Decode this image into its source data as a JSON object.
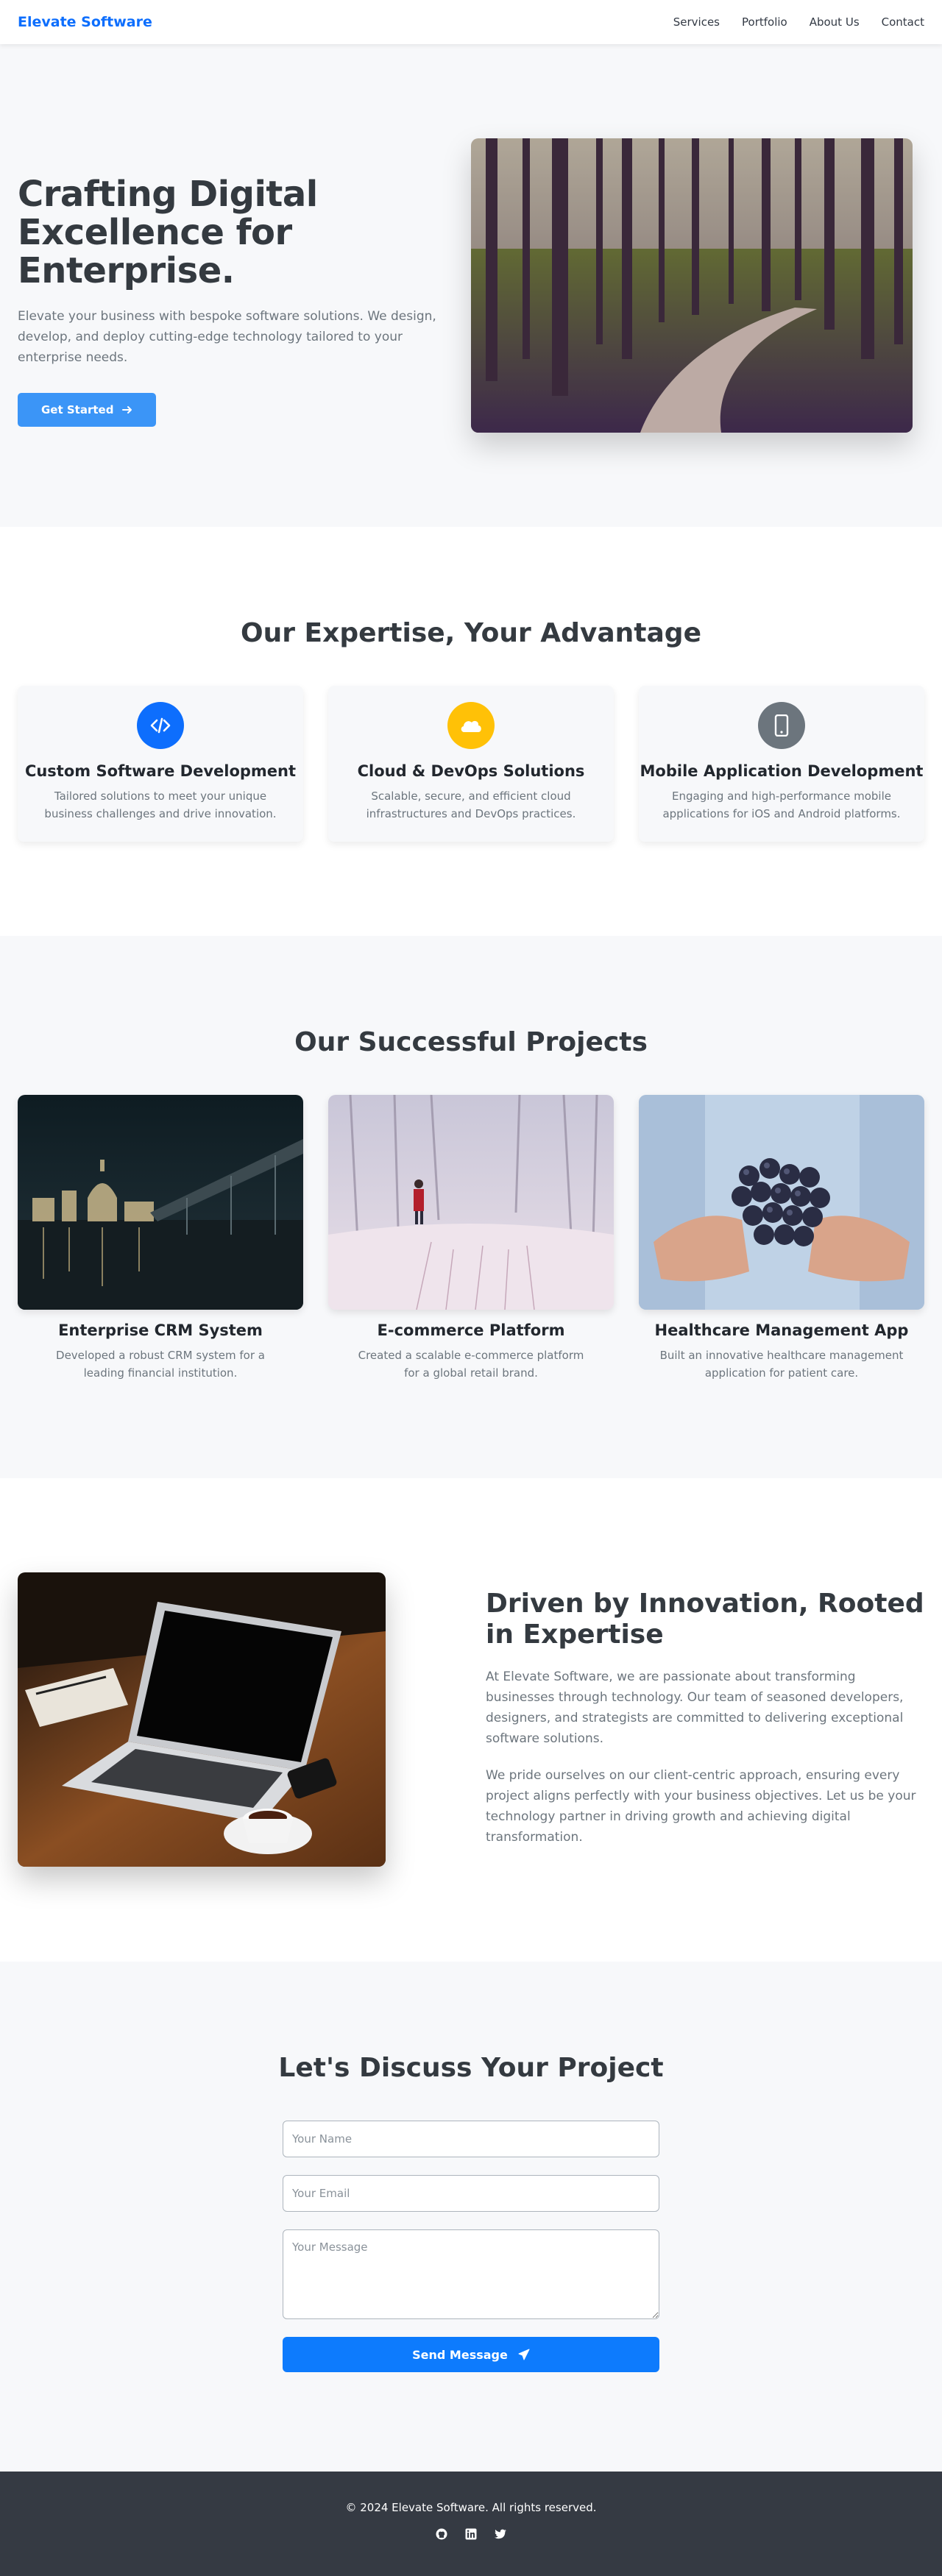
{
  "nav": {
    "brand": "Elevate Software",
    "links": [
      "Services",
      "Portfolio",
      "About Us",
      "Contact"
    ]
  },
  "hero": {
    "title_line1": "Crafting Digital",
    "title_line2": "Excellence for Enterprise.",
    "subtitle": "Elevate your business with bespoke software solutions. We design, develop, and deploy cutting-edge technology tailored to your enterprise needs.",
    "cta_label": "Get Started",
    "cta_icon": "arrow-right-icon",
    "image": "forest-path-photo"
  },
  "expertise": {
    "title": "Our Expertise, Your Advantage",
    "cards": [
      {
        "icon": "code-icon",
        "color": "#0d6efd",
        "title": "Custom Software Development",
        "desc": "Tailored solutions to meet your unique business challenges and drive innovation."
      },
      {
        "icon": "cloud-icon",
        "color": "#ffc107",
        "title": "Cloud & DevOps Solutions",
        "desc": "Scalable, secure, and efficient cloud infrastructures and DevOps practices."
      },
      {
        "icon": "mobile-icon",
        "color": "#6c757d",
        "title": "Mobile Application Development",
        "desc": "Engaging and high-performance mobile applications for iOS and Android platforms."
      }
    ]
  },
  "projects": {
    "title": "Our Successful Projects",
    "items": [
      {
        "image": "city-night-bridge-photo",
        "title": "Enterprise CRM System",
        "desc": "Developed a robust CRM system for a leading financial institution."
      },
      {
        "image": "snowy-forest-person-photo",
        "title": "E-commerce Platform",
        "desc": "Created a scalable e-commerce platform for a global retail brand."
      },
      {
        "image": "hands-holding-grapes-photo",
        "title": "Healthcare Management App",
        "desc": "Built an innovative healthcare management application for patient care."
      }
    ]
  },
  "about": {
    "title": "Driven by Innovation, Rooted in Expertise",
    "p1": "At Elevate Software, we are passionate about transforming businesses through technology. Our team of seasoned developers, designers, and strategists are committed to delivering exceptional software solutions.",
    "p2": "We pride ourselves on our client-centric approach, ensuring every project aligns perfectly with your business objectives. Let us be your technology partner in driving growth and achieving digital transformation.",
    "image": "laptop-coffee-desk-photo"
  },
  "contact": {
    "title": "Let's Discuss Your Project",
    "name_placeholder": "Your Name",
    "email_placeholder": "Your Email",
    "message_placeholder": "Your Message",
    "send_label": "Send Message",
    "send_icon": "paper-plane-icon"
  },
  "footer": {
    "copyright": "© 2024 Elevate Software. All rights reserved.",
    "socials": [
      "github-icon",
      "linkedin-icon",
      "twitter-icon"
    ]
  },
  "colors": {
    "brand": "#0d6efd",
    "primary_button": "#3b95f7",
    "send_button": "#0d7bfd",
    "footer_bg": "#353a43",
    "section_alt_bg": "#f7f8fa"
  }
}
